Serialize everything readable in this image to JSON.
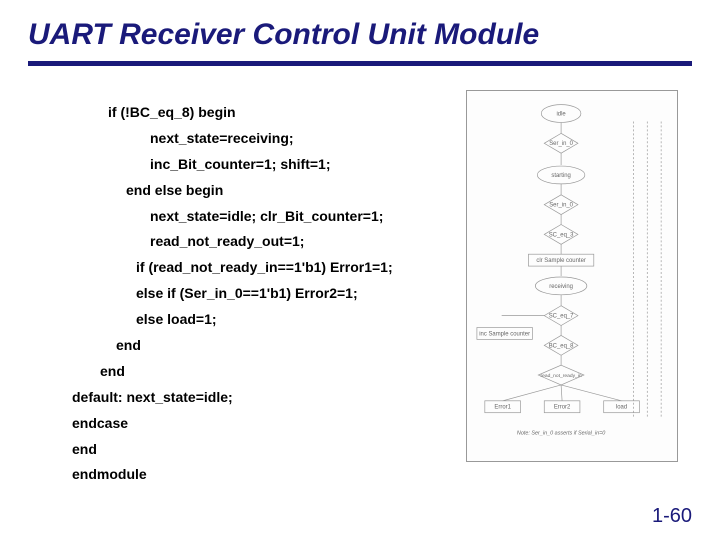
{
  "title": "UART Receiver Control Unit Module",
  "code": {
    "l1": "if (!BC_eq_8)  begin",
    "l2": "next_state=receiving;",
    "l3": "inc_Bit_counter=1; shift=1;",
    "l4": "end else begin",
    "l5": "next_state=idle; clr_Bit_counter=1;",
    "l6": "read_not_ready_out=1;",
    "l7": "if (read_not_ready_in==1'b1) Error1=1;",
    "l8": "else if (Ser_in_0==1'b1) Error2=1;",
    "l9": "else load=1;",
    "l10": "end",
    "l11": "end",
    "l12": "default: next_state=idle;",
    "l13": "endcase",
    "l14": "end",
    "l15": "endmodule"
  },
  "page_number": "1-60",
  "diagram": {
    "idle": "idle",
    "starting": "starting",
    "receiving": "receiving",
    "ser_in_0": "Ser_in_0",
    "sc_eq_3": "SC_eq_3",
    "clr_sc": "clr Sample counter",
    "inc_sc": "inc Sample counter",
    "sc_eq_7": "SC_eq_7",
    "bc_eq_8": "BC_eq_8",
    "read_nr": "read_not_ready_in",
    "error1": "Error1",
    "error2": "Error2",
    "load": "load",
    "note": "Note: Ser_in_0 asserts if Serial_in=0"
  }
}
